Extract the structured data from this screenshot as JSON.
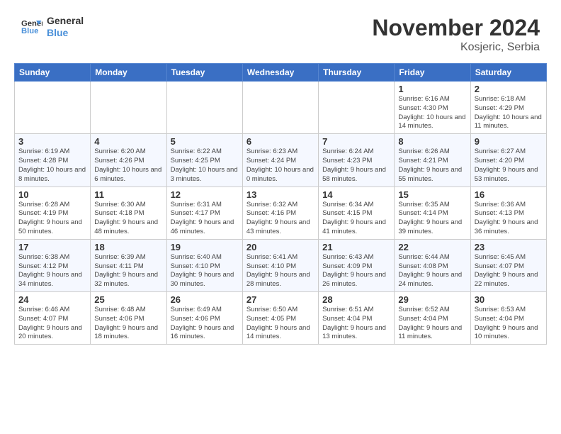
{
  "header": {
    "logo_line1": "General",
    "logo_line2": "Blue",
    "title": "November 2024",
    "subtitle": "Kosjeric, Serbia"
  },
  "days_of_week": [
    "Sunday",
    "Monday",
    "Tuesday",
    "Wednesday",
    "Thursday",
    "Friday",
    "Saturday"
  ],
  "weeks": [
    {
      "row_bg": "#fff",
      "cells": [
        {
          "day": "",
          "info": ""
        },
        {
          "day": "",
          "info": ""
        },
        {
          "day": "",
          "info": ""
        },
        {
          "day": "",
          "info": ""
        },
        {
          "day": "",
          "info": ""
        },
        {
          "day": "1",
          "info": "Sunrise: 6:16 AM\nSunset: 4:30 PM\nDaylight: 10 hours and 14 minutes."
        },
        {
          "day": "2",
          "info": "Sunrise: 6:18 AM\nSunset: 4:29 PM\nDaylight: 10 hours and 11 minutes."
        }
      ]
    },
    {
      "row_bg": "#f5f8ff",
      "cells": [
        {
          "day": "3",
          "info": "Sunrise: 6:19 AM\nSunset: 4:28 PM\nDaylight: 10 hours and 8 minutes."
        },
        {
          "day": "4",
          "info": "Sunrise: 6:20 AM\nSunset: 4:26 PM\nDaylight: 10 hours and 6 minutes."
        },
        {
          "day": "5",
          "info": "Sunrise: 6:22 AM\nSunset: 4:25 PM\nDaylight: 10 hours and 3 minutes."
        },
        {
          "day": "6",
          "info": "Sunrise: 6:23 AM\nSunset: 4:24 PM\nDaylight: 10 hours and 0 minutes."
        },
        {
          "day": "7",
          "info": "Sunrise: 6:24 AM\nSunset: 4:23 PM\nDaylight: 9 hours and 58 minutes."
        },
        {
          "day": "8",
          "info": "Sunrise: 6:26 AM\nSunset: 4:21 PM\nDaylight: 9 hours and 55 minutes."
        },
        {
          "day": "9",
          "info": "Sunrise: 6:27 AM\nSunset: 4:20 PM\nDaylight: 9 hours and 53 minutes."
        }
      ]
    },
    {
      "row_bg": "#fff",
      "cells": [
        {
          "day": "10",
          "info": "Sunrise: 6:28 AM\nSunset: 4:19 PM\nDaylight: 9 hours and 50 minutes."
        },
        {
          "day": "11",
          "info": "Sunrise: 6:30 AM\nSunset: 4:18 PM\nDaylight: 9 hours and 48 minutes."
        },
        {
          "day": "12",
          "info": "Sunrise: 6:31 AM\nSunset: 4:17 PM\nDaylight: 9 hours and 46 minutes."
        },
        {
          "day": "13",
          "info": "Sunrise: 6:32 AM\nSunset: 4:16 PM\nDaylight: 9 hours and 43 minutes."
        },
        {
          "day": "14",
          "info": "Sunrise: 6:34 AM\nSunset: 4:15 PM\nDaylight: 9 hours and 41 minutes."
        },
        {
          "day": "15",
          "info": "Sunrise: 6:35 AM\nSunset: 4:14 PM\nDaylight: 9 hours and 39 minutes."
        },
        {
          "day": "16",
          "info": "Sunrise: 6:36 AM\nSunset: 4:13 PM\nDaylight: 9 hours and 36 minutes."
        }
      ]
    },
    {
      "row_bg": "#f5f8ff",
      "cells": [
        {
          "day": "17",
          "info": "Sunrise: 6:38 AM\nSunset: 4:12 PM\nDaylight: 9 hours and 34 minutes."
        },
        {
          "day": "18",
          "info": "Sunrise: 6:39 AM\nSunset: 4:11 PM\nDaylight: 9 hours and 32 minutes."
        },
        {
          "day": "19",
          "info": "Sunrise: 6:40 AM\nSunset: 4:10 PM\nDaylight: 9 hours and 30 minutes."
        },
        {
          "day": "20",
          "info": "Sunrise: 6:41 AM\nSunset: 4:10 PM\nDaylight: 9 hours and 28 minutes."
        },
        {
          "day": "21",
          "info": "Sunrise: 6:43 AM\nSunset: 4:09 PM\nDaylight: 9 hours and 26 minutes."
        },
        {
          "day": "22",
          "info": "Sunrise: 6:44 AM\nSunset: 4:08 PM\nDaylight: 9 hours and 24 minutes."
        },
        {
          "day": "23",
          "info": "Sunrise: 6:45 AM\nSunset: 4:07 PM\nDaylight: 9 hours and 22 minutes."
        }
      ]
    },
    {
      "row_bg": "#fff",
      "cells": [
        {
          "day": "24",
          "info": "Sunrise: 6:46 AM\nSunset: 4:07 PM\nDaylight: 9 hours and 20 minutes."
        },
        {
          "day": "25",
          "info": "Sunrise: 6:48 AM\nSunset: 4:06 PM\nDaylight: 9 hours and 18 minutes."
        },
        {
          "day": "26",
          "info": "Sunrise: 6:49 AM\nSunset: 4:06 PM\nDaylight: 9 hours and 16 minutes."
        },
        {
          "day": "27",
          "info": "Sunrise: 6:50 AM\nSunset: 4:05 PM\nDaylight: 9 hours and 14 minutes."
        },
        {
          "day": "28",
          "info": "Sunrise: 6:51 AM\nSunset: 4:04 PM\nDaylight: 9 hours and 13 minutes."
        },
        {
          "day": "29",
          "info": "Sunrise: 6:52 AM\nSunset: 4:04 PM\nDaylight: 9 hours and 11 minutes."
        },
        {
          "day": "30",
          "info": "Sunrise: 6:53 AM\nSunset: 4:04 PM\nDaylight: 9 hours and 10 minutes."
        }
      ]
    }
  ]
}
